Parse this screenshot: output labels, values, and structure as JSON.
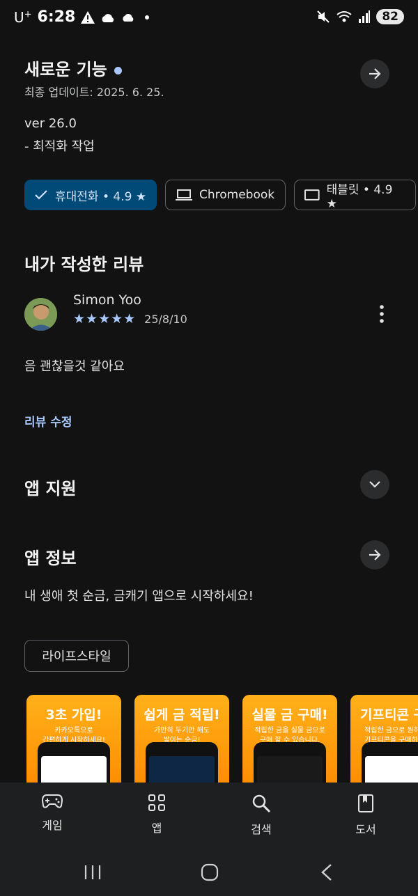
{
  "status_bar": {
    "carrier": "U",
    "carrier_sup": "+",
    "time": "6:28",
    "battery": "82"
  },
  "whats_new": {
    "title": "새로운 기능",
    "updated": "최종 업데이트: 2025. 6. 25.",
    "version": "ver 26.0",
    "note": "- 최적화 작업"
  },
  "devices": [
    {
      "label": "휴대전화 • 4.9 ★",
      "icon": "check-icon",
      "selected": true
    },
    {
      "label": "Chromebook",
      "icon": "laptop-icon",
      "selected": false
    },
    {
      "label": "태블릿 • 4.9 ★",
      "icon": "tablet-icon",
      "selected": false
    }
  ],
  "my_review": {
    "title": "내가 작성한 리뷰",
    "author": "Simon Yoo",
    "rating": 5,
    "stars": "★★★★★",
    "date": "25/8/10",
    "text": "음 괜찮을것 같아요",
    "edit_label": "리뷰 수정"
  },
  "app_support": {
    "title": "앱 지원"
  },
  "app_info": {
    "title": "앱 정보",
    "description": "내 생애 첫 순금, 금캐기 앱으로 시작하세요!",
    "category": "라이프스타일"
  },
  "screenshots": [
    {
      "title": "3초 가입!",
      "sub1": "카카오톡으로",
      "sub2": "간편하게 시작하세요!"
    },
    {
      "title": "쉽게 금 적립!",
      "sub1": "가만히 두기만 해도",
      "sub2": "쌓이는 순금!"
    },
    {
      "title": "실물 금 구매!",
      "sub1": "적립한 금을 실물 금으로",
      "sub2": "구매 할 수 있습니다."
    },
    {
      "title": "기프티콘 구",
      "sub1": "적립한 금으로 원하",
      "sub2": "기프티콘을 구매하세"
    }
  ],
  "bottom_nav": [
    {
      "label": "게임",
      "icon": "gamepad-icon"
    },
    {
      "label": "앱",
      "icon": "apps-grid-icon"
    },
    {
      "label": "검색",
      "icon": "search-icon"
    },
    {
      "label": "도서",
      "icon": "book-icon"
    }
  ],
  "colors": {
    "background": "#121212",
    "accent": "#a8c7fa",
    "chip_selected": "#004a77"
  }
}
